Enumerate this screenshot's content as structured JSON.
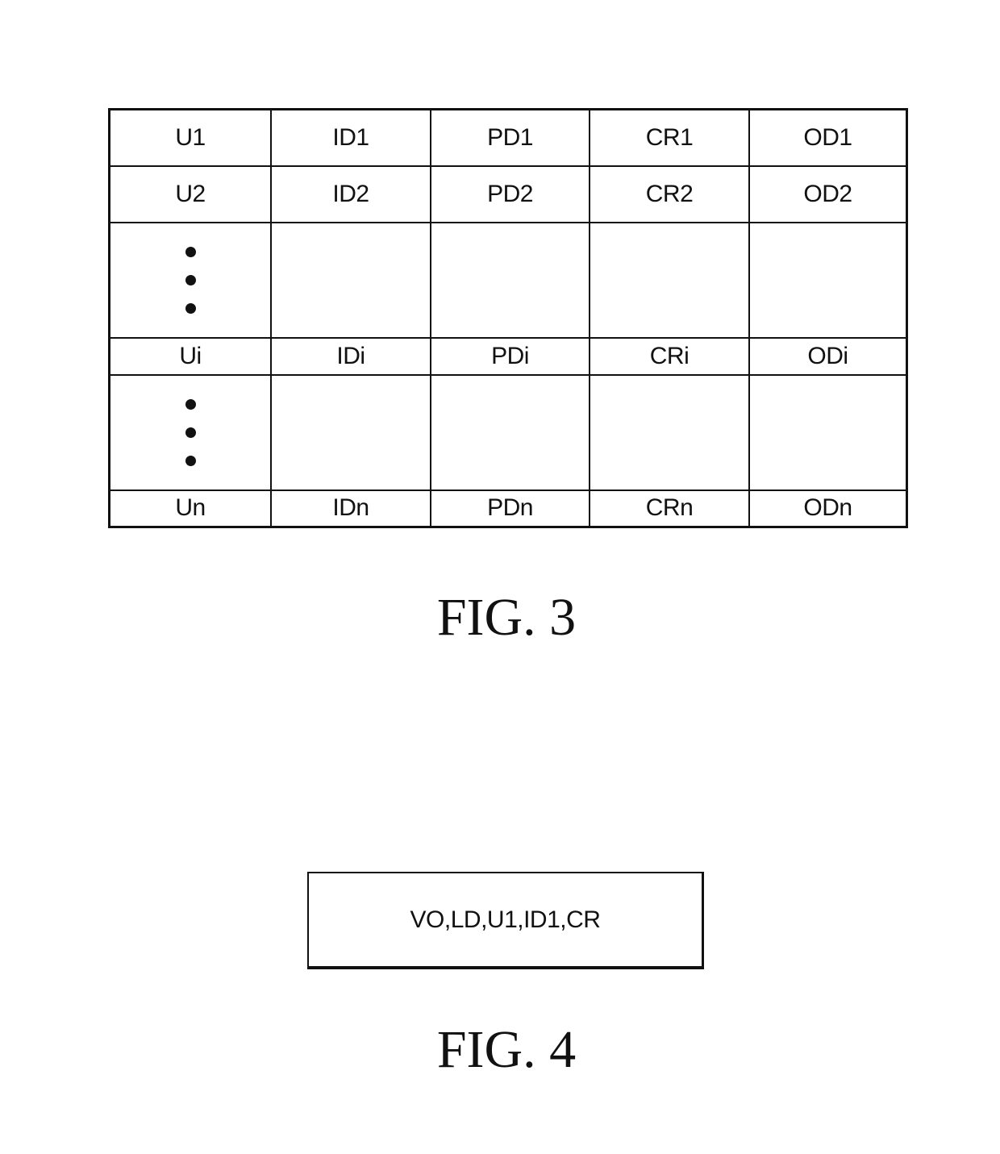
{
  "fig3": {
    "caption": "FIG. 3",
    "rows": [
      {
        "type": "entry",
        "cells": [
          "U1",
          "ID1",
          "PD1",
          "CR1",
          "OD1"
        ]
      },
      {
        "type": "entry",
        "cells": [
          "U2",
          "ID2",
          "PD2",
          "CR2",
          "OD2"
        ]
      },
      {
        "type": "ellipsis",
        "cells": [
          "",
          "",
          "",
          "",
          ""
        ]
      },
      {
        "type": "entry",
        "cells": [
          "Ui",
          "IDi",
          "PDi",
          "CRi",
          "ODi"
        ]
      },
      {
        "type": "ellipsis",
        "cells": [
          "",
          "",
          "",
          "",
          ""
        ]
      },
      {
        "type": "entry",
        "cells": [
          "Un",
          "IDn",
          "PDn",
          "CRn",
          "ODn"
        ]
      }
    ]
  },
  "fig4": {
    "caption": "FIG. 4",
    "box_text": "VO,LD,U1,ID1,CR"
  }
}
